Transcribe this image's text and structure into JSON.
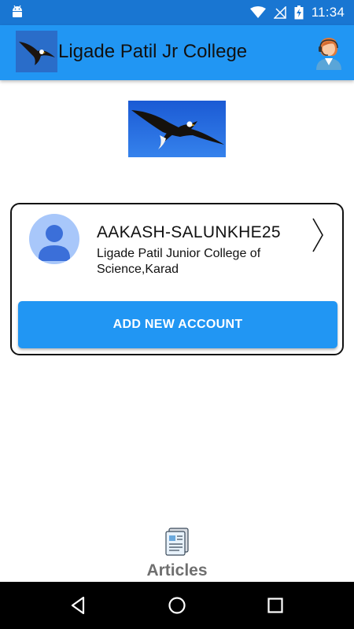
{
  "status_bar": {
    "time": "11:34",
    "icons": [
      "android-icon",
      "wifi-icon",
      "no-signal-icon",
      "battery-charging-icon"
    ]
  },
  "app_bar": {
    "title": "Ligade Patil Jr College",
    "logo": "eagle-logo",
    "action_icon": "support-agent-icon"
  },
  "account": {
    "name": "AAKASH-SALUNKHE25",
    "college": "Ligade Patil Junior College of Science,Karad",
    "add_button_label": "ADD NEW ACCOUNT"
  },
  "bottom_tab": {
    "label": "Articles",
    "icon": "articles-icon"
  },
  "nav_bar": {
    "buttons": [
      "back-icon",
      "home-icon",
      "recents-icon"
    ]
  },
  "colors": {
    "status_bar": "#1976d2",
    "app_bar": "#2196f3",
    "button": "#2196f3",
    "avatar_bg": "#a8c7fa"
  }
}
